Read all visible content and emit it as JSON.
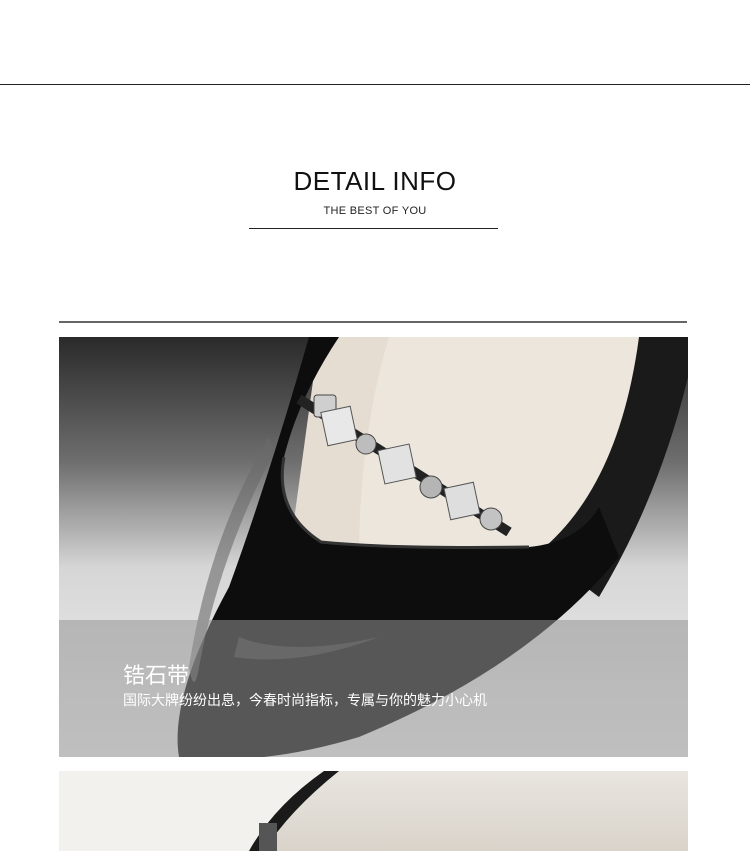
{
  "header": {
    "title": "DETAIL INFO",
    "subtitle": "THE BEST OF YOU"
  },
  "feature": {
    "title": "锆石带",
    "description": "国际大牌纷纷出息，今春时尚指标，专属与你的魅力小心机"
  },
  "colors": {
    "rule": "#222222",
    "overlay": "#969696",
    "shoe": "#111111",
    "lining": "#e3dcd2"
  }
}
